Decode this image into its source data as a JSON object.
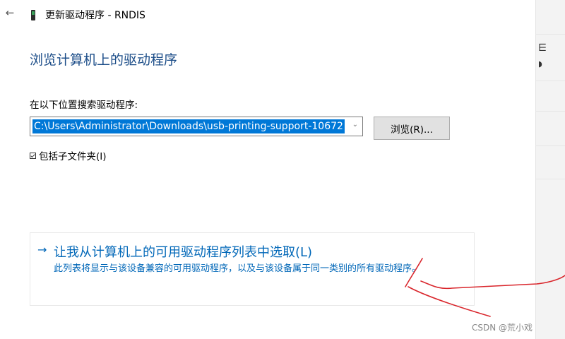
{
  "window": {
    "title": "更新驱动程序 - RNDIS",
    "back_icon": "back-arrow-icon",
    "device_icon": "device-icon"
  },
  "content": {
    "heading": "浏览计算机上的驱动程序",
    "search_label": "在以下位置搜索驱动程序:",
    "path_value": "C:\\Users\\Administrator\\Downloads\\usb-printing-support-10672",
    "browse_button": "浏览(R)...",
    "include_subfolders_label": "包括子文件夹(I)",
    "include_subfolders_checked": true
  },
  "pick_option": {
    "arrow": "→",
    "title": "让我从计算机上的可用驱动程序列表中选取(L)",
    "description": "此列表将显示与该设备兼容的可用驱动程序，以及与该设备属于同一类别的所有驱动程序。"
  },
  "watermark": "CSDN @荒小戏",
  "colors": {
    "heading": "#1d4e89",
    "link": "#0067b8",
    "selection": "#0078d7",
    "annotation": "#d9262c"
  }
}
